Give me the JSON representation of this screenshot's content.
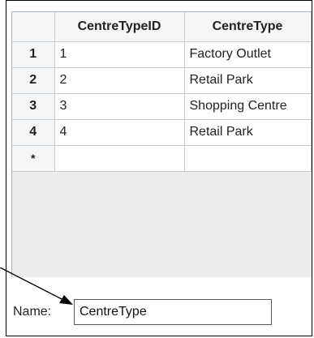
{
  "grid": {
    "columns": [
      "CentreTypeID",
      "CentreType"
    ],
    "rows": [
      {
        "selector": "1",
        "cells": [
          "1",
          "Factory Outlet"
        ]
      },
      {
        "selector": "2",
        "cells": [
          "2",
          "Retail Park"
        ]
      },
      {
        "selector": "3",
        "cells": [
          "3",
          "Shopping Centre"
        ]
      },
      {
        "selector": "4",
        "cells": [
          "4",
          "Retail Park"
        ]
      }
    ],
    "new_row_selector": "*"
  },
  "name_field": {
    "label": "Name:",
    "value": "CentreType"
  }
}
